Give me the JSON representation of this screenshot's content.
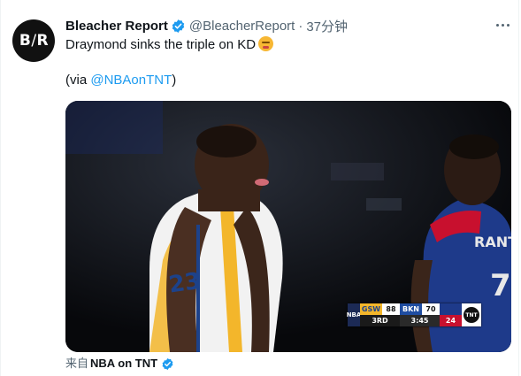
{
  "tweet": {
    "avatar_text_left": "B",
    "avatar_text_sep": "/",
    "avatar_text_right": "R",
    "author_name": "Bleacher Report",
    "author_handle": "@BleacherReport",
    "separator": "·",
    "time": "37分钟",
    "text": "Draymond sinks the triple on KD",
    "via_prefix": "(via ",
    "via_link": "@NBAonTNT",
    "via_suffix": ")",
    "source_prefix": "来自",
    "source_app": "NBA on TNT"
  },
  "media": {
    "scorebug": {
      "league_logo": "NBA",
      "team1": "GSW",
      "score1": "88",
      "team2": "BKN",
      "score2": "70",
      "period": "3RD",
      "clock": "3:45",
      "shot_clock": "24",
      "network": "TNT"
    }
  },
  "icons": {
    "verified": "verified-badge-icon",
    "more": "more-options-icon",
    "emoji": "angry-face-emoji-icon"
  },
  "colors": {
    "accent": "#1d9bf0",
    "secondary_text": "#536471",
    "primary_text": "#0f1419"
  }
}
